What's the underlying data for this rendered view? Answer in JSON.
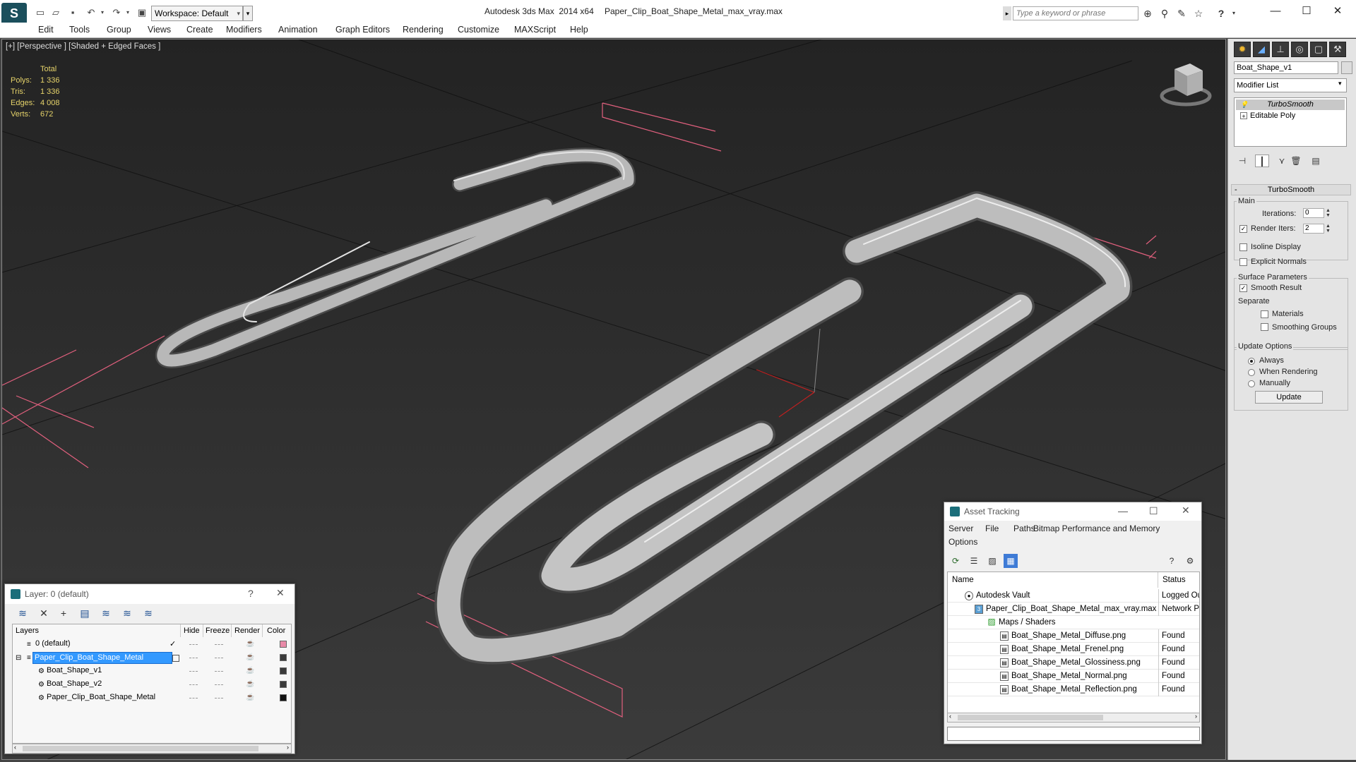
{
  "titlebar": {
    "workspace_label": "Workspace: Default",
    "app_title": "Autodesk 3ds Max  2014 x64",
    "file_title": "Paper_Clip_Boat_Shape_Metal_max_vray.max",
    "search_placeholder": "Type a keyword or phrase"
  },
  "menu": [
    "Edit",
    "Tools",
    "Group",
    "Views",
    "Create",
    "Modifiers",
    "Animation",
    "Graph Editors",
    "Rendering",
    "Customize",
    "MAXScript",
    "Help"
  ],
  "viewport": {
    "label": "[+] [Perspective ] [Shaded + Edged Faces ]",
    "stats": {
      "header": "Total",
      "rows": [
        {
          "k": "Polys:",
          "v": "1 336"
        },
        {
          "k": "Tris:",
          "v": "1 336"
        },
        {
          "k": "Edges:",
          "v": "4 008"
        },
        {
          "k": "Verts:",
          "v": "672"
        }
      ]
    }
  },
  "command_panel": {
    "object_name": "Boat_Shape_v1",
    "modifier_list": "Modifier List",
    "stack": [
      "TurboSmooth",
      "Editable Poly"
    ],
    "rollout_title": "TurboSmooth",
    "main_group": "Main",
    "iterations_label": "Iterations:",
    "iterations_value": "0",
    "render_iters_label": "Render Iters:",
    "render_iters_value": "2",
    "isoline_label": "Isoline Display",
    "explicit_normals_label": "Explicit Normals",
    "surface_group": "Surface Parameters",
    "smooth_result_label": "Smooth Result",
    "separate_label": "Separate",
    "materials_label": "Materials",
    "smoothing_groups_label": "Smoothing Groups",
    "update_group": "Update Options",
    "always_label": "Always",
    "when_rendering_label": "When Rendering",
    "manually_label": "Manually",
    "update_button": "Update"
  },
  "layers_panel": {
    "title": "Layer: 0 (default)",
    "help": "?",
    "columns": [
      "Layers",
      "Hide",
      "Freeze",
      "Render",
      "Color"
    ],
    "rows": [
      {
        "name": "0 (default)",
        "color": "#e88aa8"
      },
      {
        "name": "Paper_Clip_Boat_Shape_Metal",
        "color": "#3a3a3a"
      },
      {
        "name": "Boat_Shape_v1",
        "color": "#3a3a3a"
      },
      {
        "name": "Boat_Shape_v2",
        "color": "#3a3a3a"
      },
      {
        "name": "Paper_Clip_Boat_Shape_Metal",
        "color": "#111111"
      }
    ]
  },
  "asset_tracking": {
    "title": "Asset Tracking",
    "menu": [
      "Server",
      "File",
      "Paths",
      "Bitmap Performance and Memory",
      "Options"
    ],
    "columns": [
      "Name",
      "Status"
    ],
    "rows": [
      {
        "name": "Autodesk Vault",
        "status": "Logged Ou"
      },
      {
        "name": "Paper_Clip_Boat_Shape_Metal_max_vray.max",
        "status": "Network P"
      },
      {
        "name": "Maps / Shaders",
        "status": ""
      },
      {
        "name": "Boat_Shape_Metal_Diffuse.png",
        "status": "Found"
      },
      {
        "name": "Boat_Shape_Metal_Frenel.png",
        "status": "Found"
      },
      {
        "name": "Boat_Shape_Metal_Glossiness.png",
        "status": "Found"
      },
      {
        "name": "Boat_Shape_Metal_Normal.png",
        "status": "Found"
      },
      {
        "name": "Boat_Shape_Metal_Reflection.png",
        "status": "Found"
      }
    ]
  }
}
